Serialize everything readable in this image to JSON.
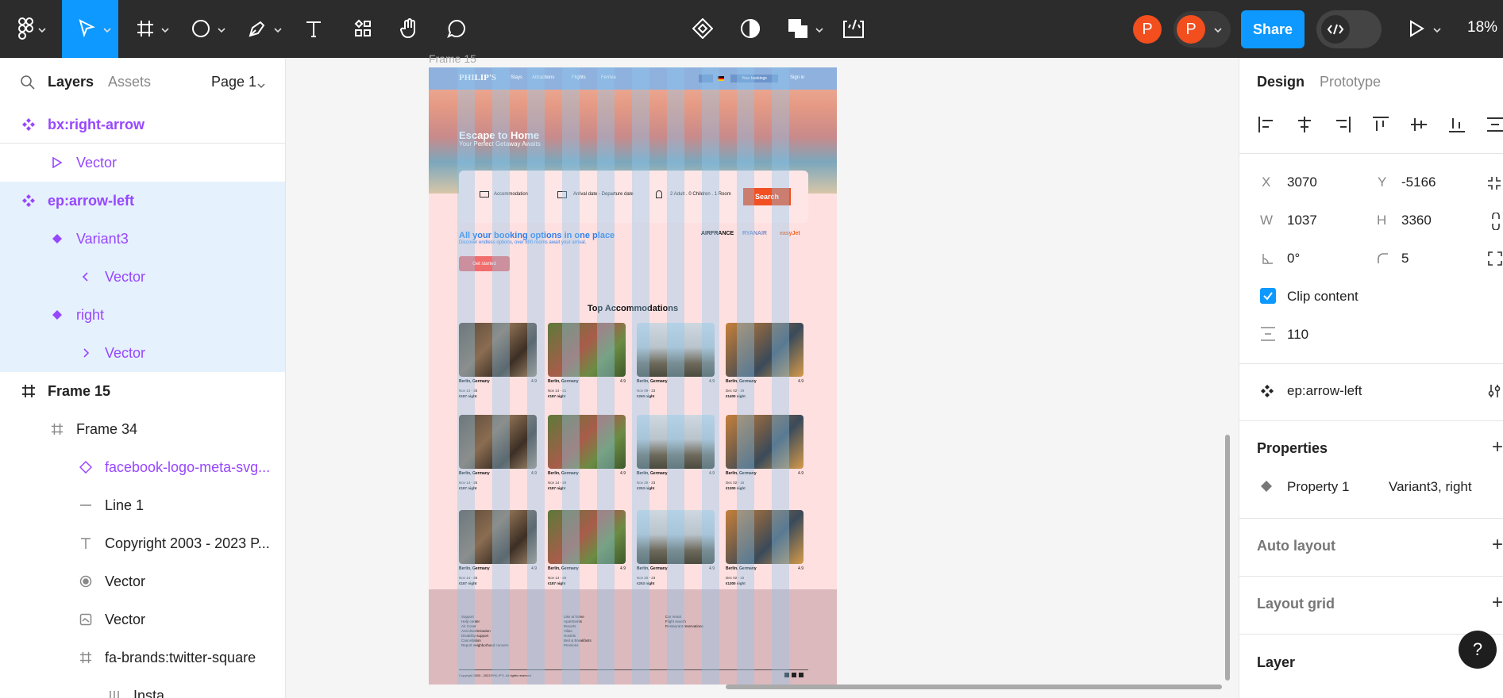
{
  "toolbar": {
    "user1": "P",
    "user2": "P",
    "share": "Share",
    "zoom": "18%"
  },
  "left_panel": {
    "tab_layers": "Layers",
    "tab_assets": "Assets",
    "page": "Page 1",
    "layers": [
      {
        "label": "bx:right-arrow"
      },
      {
        "label": "Vector"
      },
      {
        "label": "ep:arrow-left"
      },
      {
        "label": "Variant3"
      },
      {
        "label": "Vector"
      },
      {
        "label": "right"
      },
      {
        "label": "Vector"
      },
      {
        "label": "Frame 15"
      },
      {
        "label": "Frame 34"
      },
      {
        "label": "facebook-logo-meta-svg..."
      },
      {
        "label": "Line 1"
      },
      {
        "label": "Copyright 2003 - 2023 P..."
      },
      {
        "label": "Vector"
      },
      {
        "label": "Vector"
      },
      {
        "label": "fa-brands:twitter-square"
      },
      {
        "label": "Insta"
      }
    ]
  },
  "canvas": {
    "frame_label": "Frame 15",
    "site": {
      "logo": "PHILIP'S",
      "nav_items": [
        "Stays",
        "Attractions",
        "Flights",
        "Ferries"
      ],
      "bookings": "Your bookings",
      "signin": "Sign in",
      "hero_title": "Escape to Home",
      "hero_sub": "Your Perfect Getaway Awaits",
      "field_accommodation": "Accommodation",
      "field_dates": "Arrival date - Departure date",
      "field_guests": "2 Adult . 0 Children . 1 Room",
      "search": "Search",
      "booking_title": "All your booking options in one place",
      "booking_sub": "Discover endless options, over 800 rooms await your arrival.",
      "get_started": "Get started",
      "partners": [
        "AIRFRANCE",
        "RYANAIR",
        "easyJet"
      ],
      "top_title": "Top Accommodations",
      "cards": [
        {
          "city": "Berlin, Germany",
          "rating": "4.9",
          "date": "Nov 14 - 25",
          "price": "€187 night"
        },
        {
          "city": "Berlin, Germany",
          "rating": "4.9",
          "date": "Nov 14 - 21",
          "price": "€187 night"
        },
        {
          "city": "Berlin, Germany",
          "rating": "4.9",
          "date": "Nov 09 - 23",
          "price": "€260 night"
        },
        {
          "city": "Berlin, Germany",
          "rating": "4.9",
          "date": "Dec 02 - 19",
          "price": "€1400 night"
        },
        {
          "city": "Berlin, Germany",
          "rating": "4.9",
          "date": "Nov 14 - 25",
          "price": "€187 night"
        },
        {
          "city": "Berlin, Germany",
          "rating": "4.9",
          "date": "Nov 14 - 26",
          "price": "€187 night"
        },
        {
          "city": "Berlin, Germany",
          "rating": "4.9",
          "date": "Nov 20 - 23",
          "price": "€253 night"
        },
        {
          "city": "Berlin, Germany",
          "rating": "4.9",
          "date": "Dec 02 - 15",
          "price": "€1300 night"
        },
        {
          "city": "Berlin, Germany",
          "rating": "4.9",
          "date": "Nov 14 - 25",
          "price": "€187 night"
        },
        {
          "city": "Berlin, Germany",
          "rating": "4.9",
          "date": "Nov 14 - 26",
          "price": "€187 night"
        },
        {
          "city": "Berlin, Germany",
          "rating": "4.9",
          "date": "Nov 20 - 23",
          "price": "€253 night"
        },
        {
          "city": "Berlin, Germany",
          "rating": "4.9",
          "date": "Dec 02 - 15",
          "price": "€1300 night"
        }
      ],
      "footer_support": "Support\nHelp center\nAir Cover\nAnti-discrimination\nDisability support\nCancellation\nReport neighborhood concern",
      "footer_home": "Like at home\nApartments\nResorts\nVillas\nHostels\nBed & Breakfasts\nPensions",
      "footer_car": "Car rental\nFlight search\nRestaurant reservations",
      "copyright": "Copyright 2003 - 2023 PHILIP'S. All rights reserved."
    }
  },
  "right_panel": {
    "tab_design": "Design",
    "tab_prototype": "Prototype",
    "x_label": "X",
    "x_value": "3070",
    "y_label": "Y",
    "y_value": "-5166",
    "w_label": "W",
    "w_value": "1037",
    "h_label": "H",
    "h_value": "3360",
    "rotation": "0°",
    "radius": "5",
    "clip_content": "Clip content",
    "spacing": "110",
    "component_name": "ep:arrow-left",
    "properties_title": "Properties",
    "property_name": "Property 1",
    "property_value": "Variant3, right",
    "auto_layout": "Auto layout",
    "layout_grid": "Layout grid",
    "layer": "Layer",
    "help": "?"
  },
  "colors": {
    "toolbar_bg": "#2c2c2c",
    "accent": "#0d99ff",
    "component_purple": "#9747ff",
    "selection_bg": "#e5f1fc",
    "avatar": "#f24e1e"
  }
}
